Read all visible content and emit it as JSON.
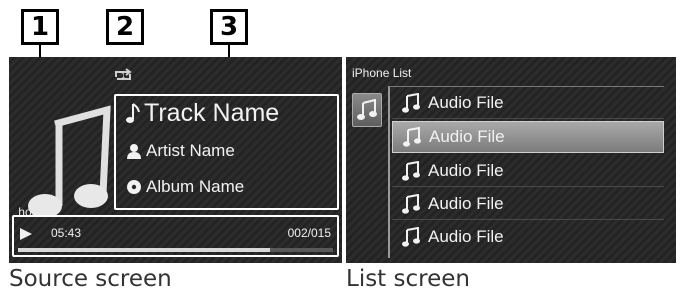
{
  "callouts": [
    "1",
    "2",
    "3"
  ],
  "source_screen": {
    "source_name": "hone",
    "track_name": "Track Name",
    "artist_name": "Artist Name",
    "album_name": "Album Name",
    "play_time": "05:43",
    "track_count": "002/015",
    "repeat_mode": "repeat-one",
    "progress": 0.8,
    "icons": [
      "music-note-icon",
      "repeat-one-icon",
      "artist-icon",
      "album-icon",
      "play-icon"
    ]
  },
  "list_screen": {
    "title": "iPhone List",
    "items": [
      {
        "label": "Audio File",
        "selected": false
      },
      {
        "label": "Audio File",
        "selected": true
      },
      {
        "label": "Audio File",
        "selected": false
      },
      {
        "label": "Audio File",
        "selected": false
      },
      {
        "label": "Audio File",
        "selected": false
      }
    ],
    "icons": [
      "music-category-icon",
      "audio-file-icon"
    ]
  },
  "captions": {
    "source": "Source screen",
    "list": "List screen"
  },
  "colors": {
    "panel_background": "#282828",
    "selected_item": "#9a9a9a",
    "text": "#f2f2f2"
  }
}
